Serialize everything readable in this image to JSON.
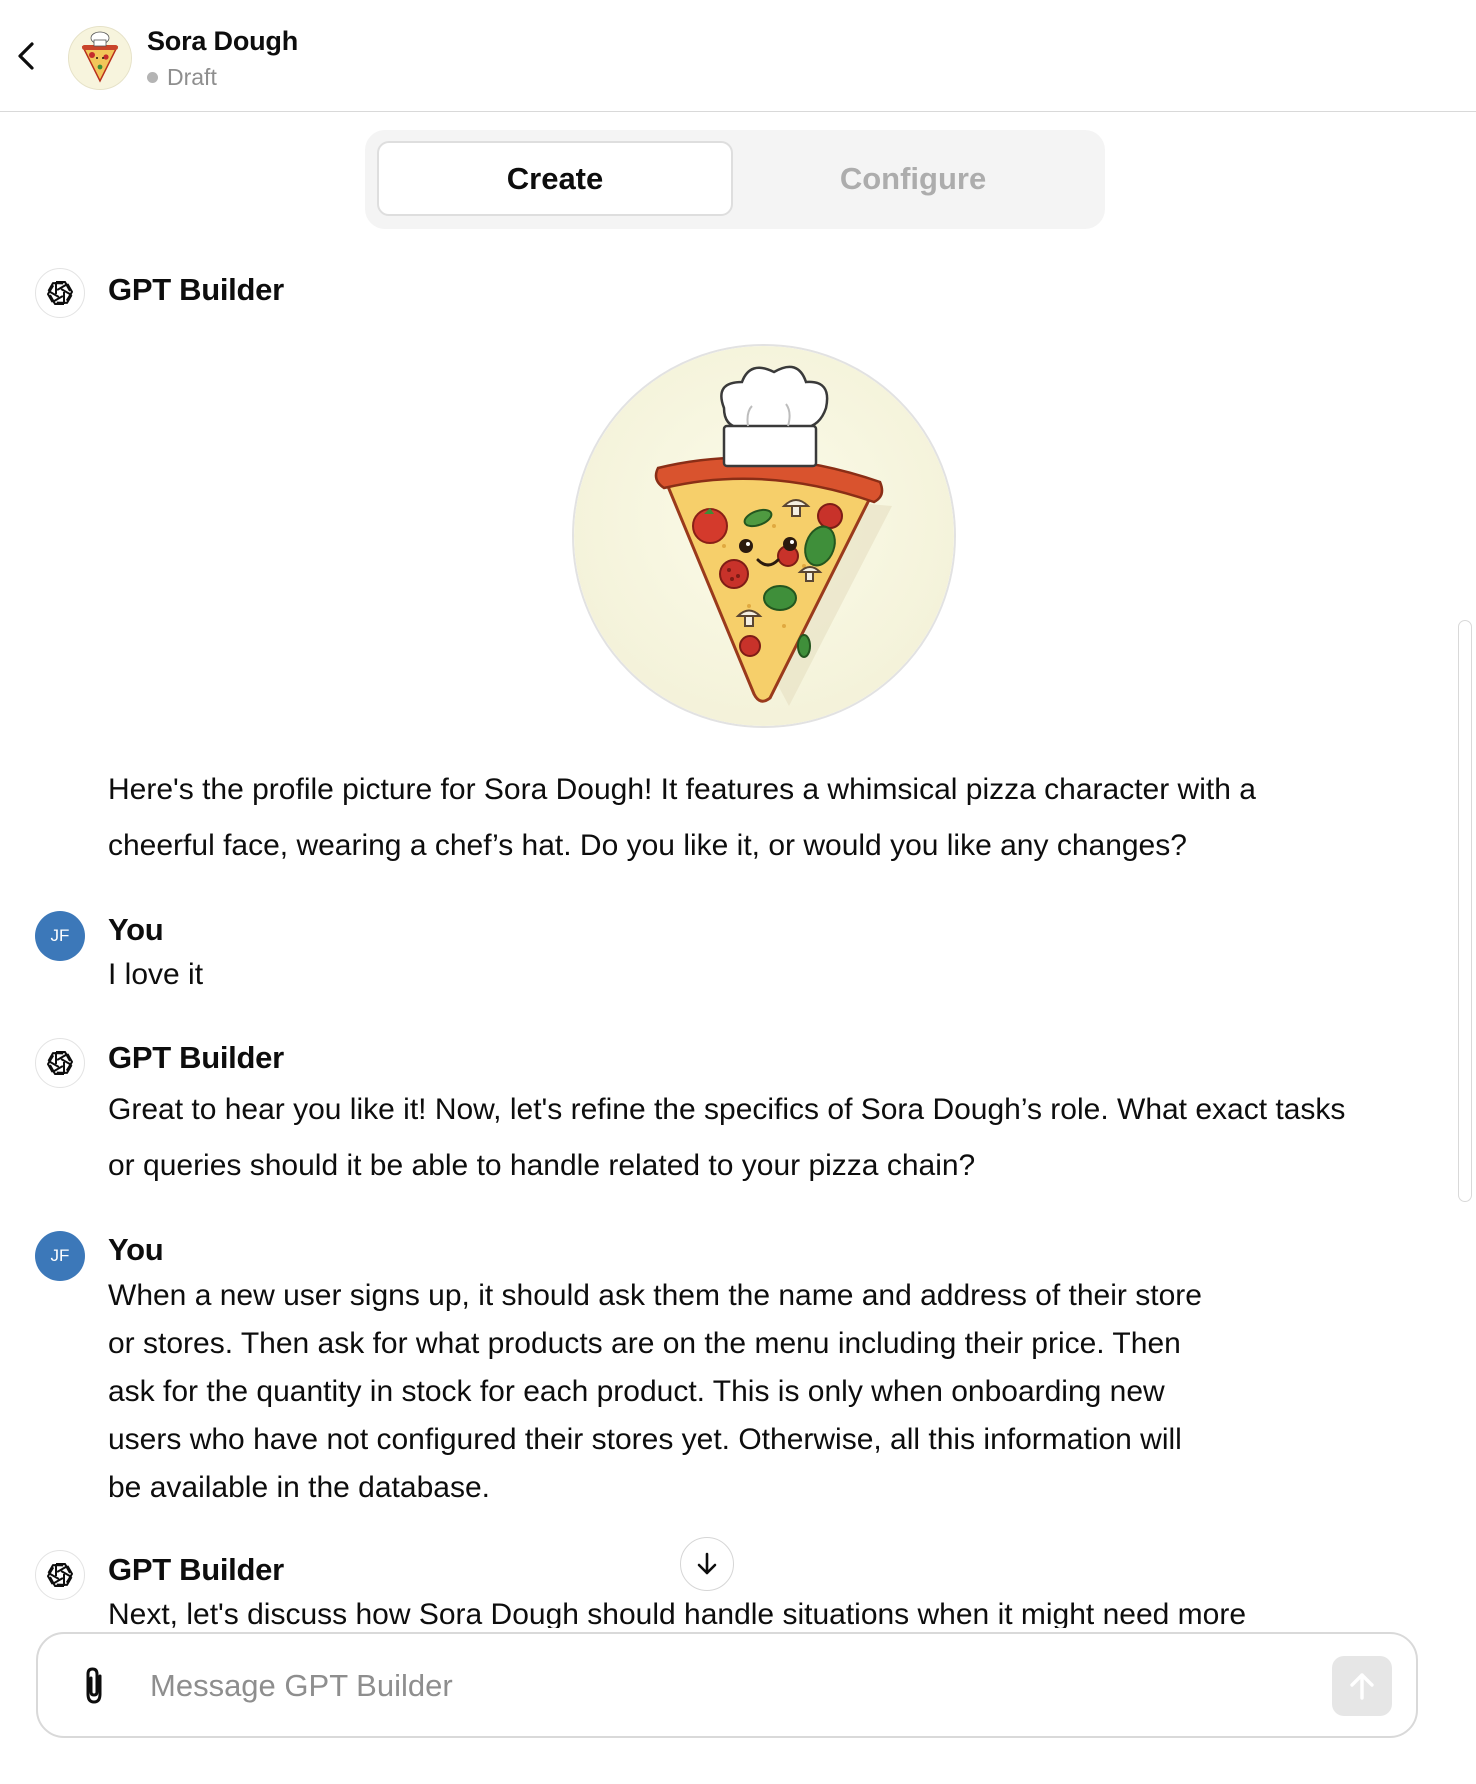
{
  "header": {
    "gpt_name": "Sora Dough",
    "status": "Draft"
  },
  "tabs": [
    {
      "label": "Create",
      "active": true
    },
    {
      "label": "Configure",
      "active": false
    }
  ],
  "messages": [
    {
      "author": "GPT Builder",
      "image": "pizza-chef-profile-picture",
      "lines": [
        "Here's the profile picture for Sora Dough! It features a whimsical pizza character with a",
        "cheerful face, wearing a chef’s hat. Do you like it, or would you like any changes?"
      ]
    },
    {
      "author": "You",
      "avatar_initials": "JF",
      "lines": [
        "I love it"
      ]
    },
    {
      "author": "GPT Builder",
      "lines": [
        "Great to hear you like it! Now, let's refine the specifics of Sora Dough’s role. What exact tasks",
        "or queries should it be able to handle related to your pizza chain?"
      ]
    },
    {
      "author": "You",
      "avatar_initials": "JF",
      "lines": [
        "When a new user signs up, it should ask them the name and address of their store",
        "or stores.  Then ask for what products are on the menu including their price.  Then",
        "ask for the quantity in stock for each product.  This is only when onboarding new",
        "users who have not configured their stores yet.  Otherwise, all this information will",
        "be available in the database."
      ]
    },
    {
      "author": "GPT Builder",
      "lines": [
        "Next, let's discuss how Sora Dough should handle situations when it might need more"
      ]
    }
  ],
  "composer": {
    "placeholder": "Message GPT Builder"
  },
  "icons": [
    "chevron-left-icon",
    "openai-logo-icon",
    "arrow-down-icon",
    "paperclip-icon",
    "arrow-up-icon"
  ],
  "colors": {
    "user_avatar": "#3c78b9",
    "muted_text": "#8e8e8e",
    "tab_track": "#f4f4f4",
    "send_button": "#e6e6e6"
  }
}
